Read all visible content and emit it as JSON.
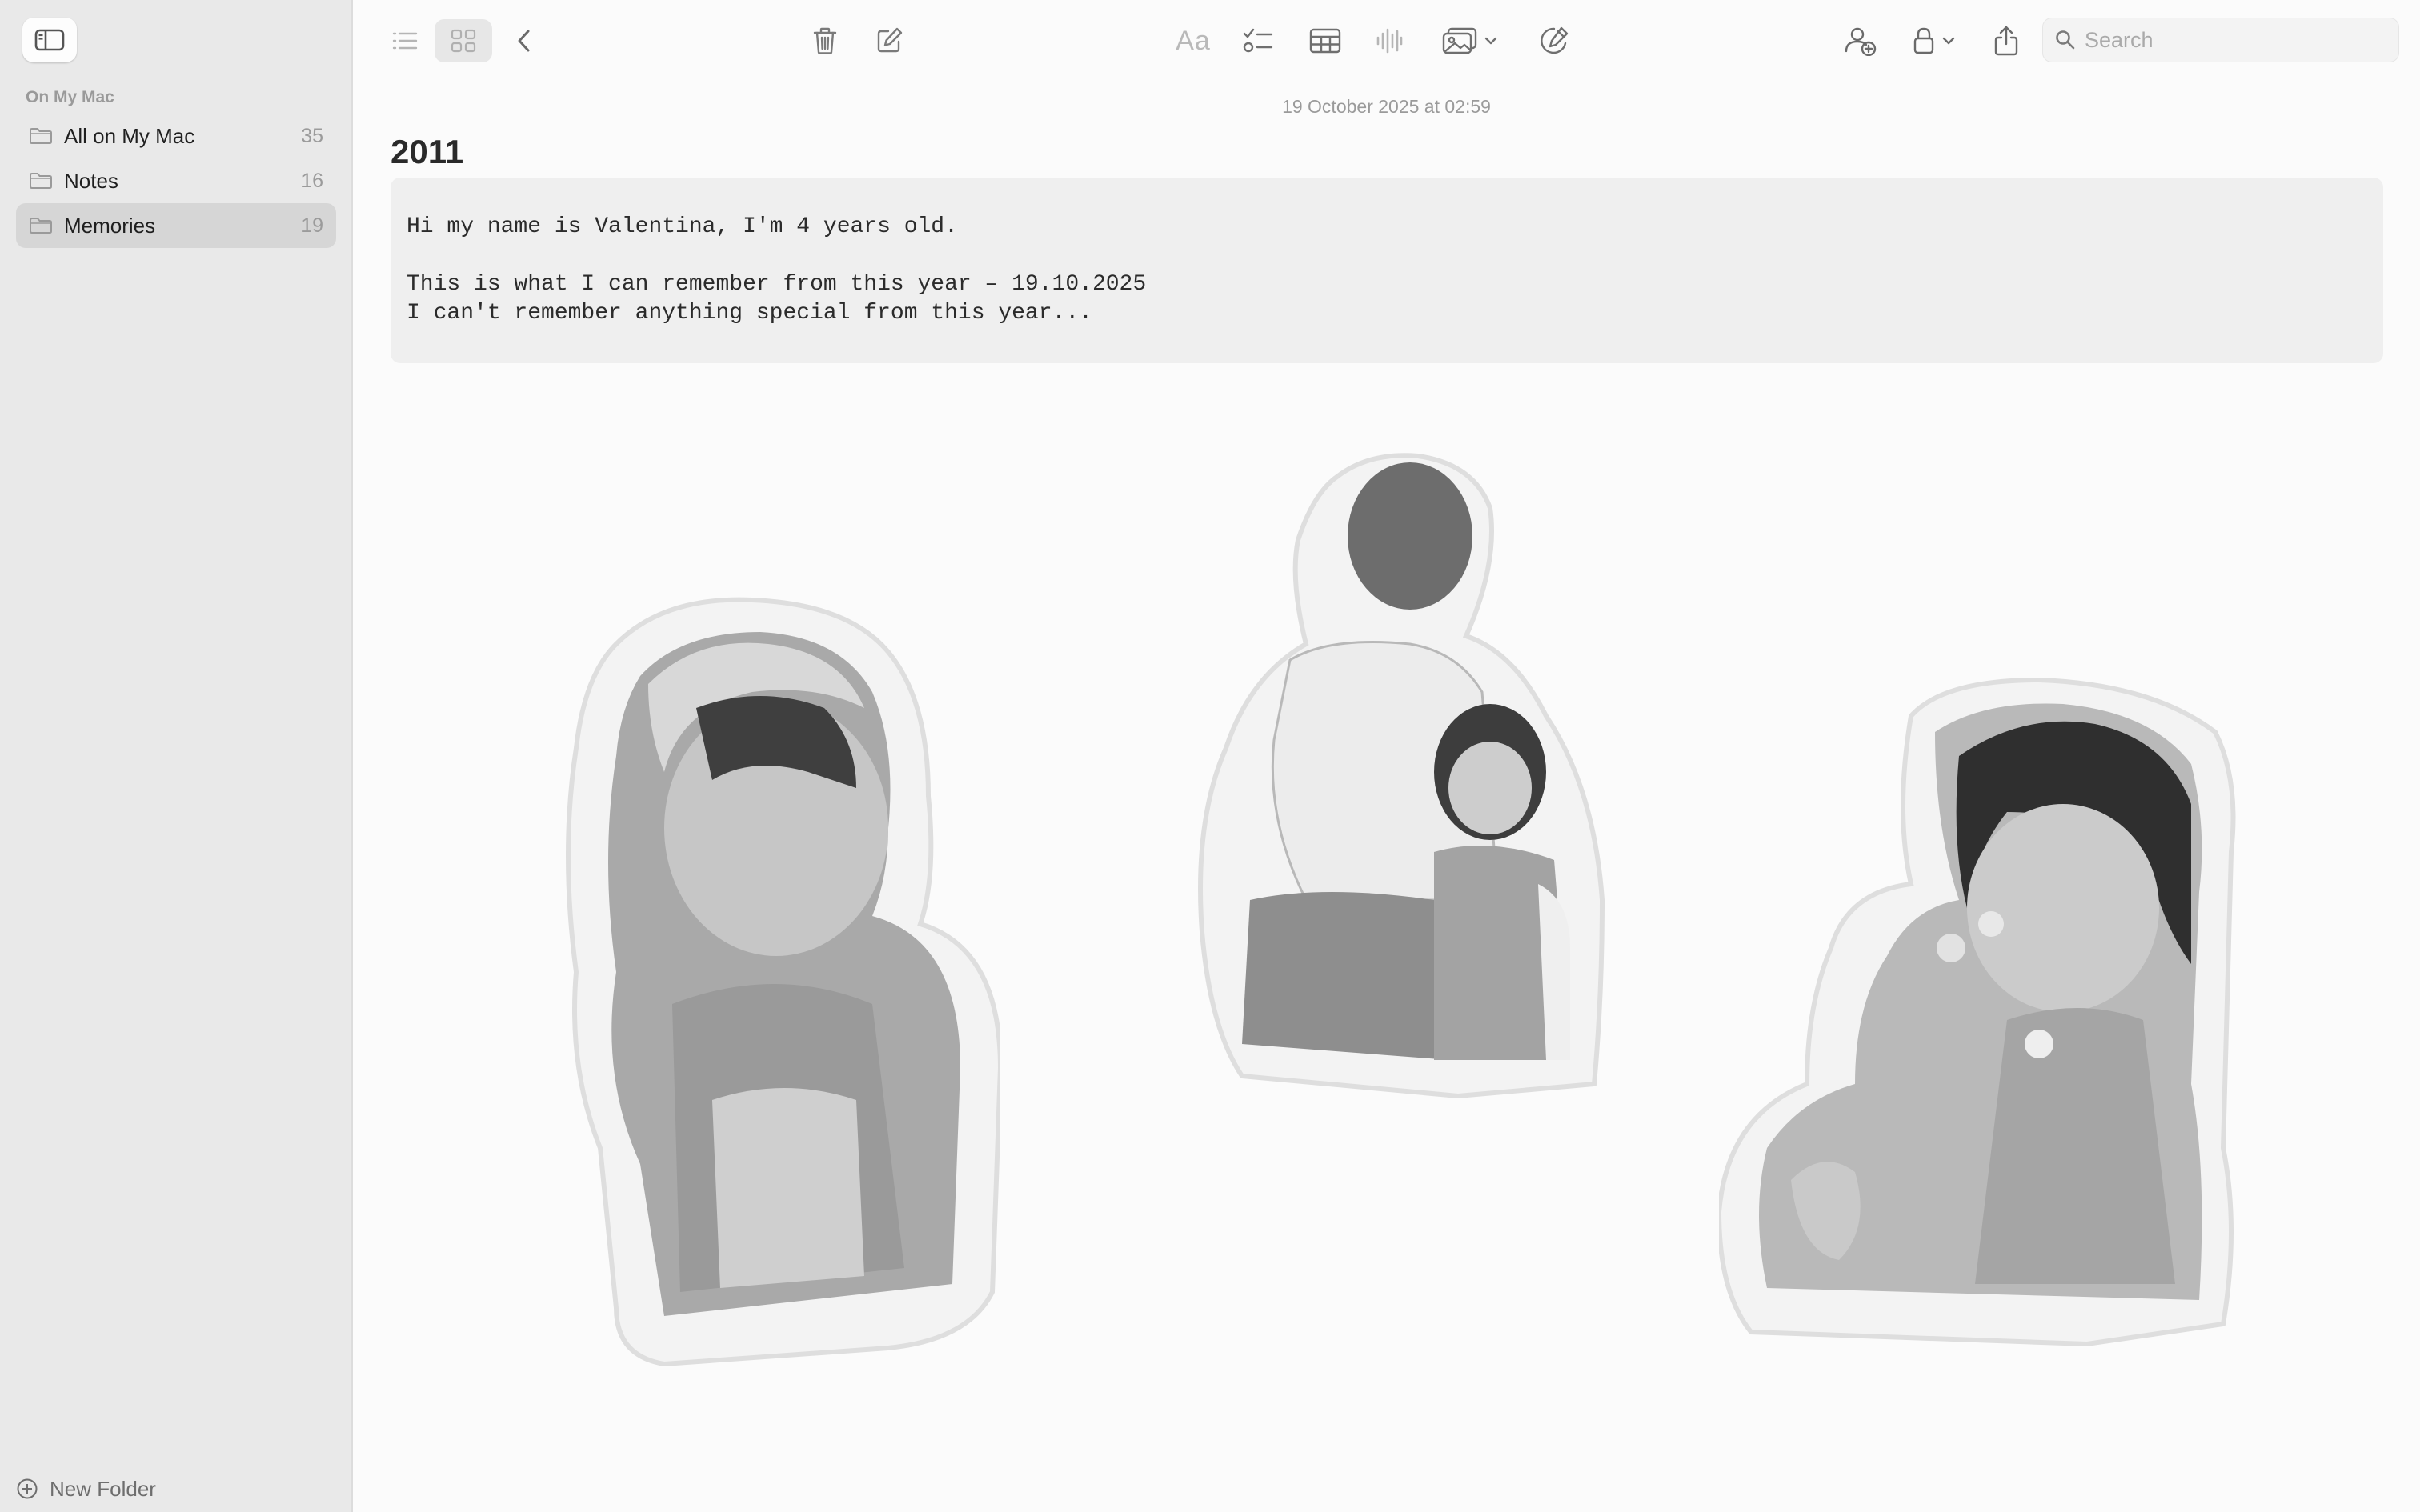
{
  "sidebar": {
    "toggle_icon": "sidebar-icon",
    "section_label": "On My Mac",
    "folders": [
      {
        "name": "All on My Mac",
        "count": "35",
        "icon": "folder-icon",
        "selected": false
      },
      {
        "name": "Notes",
        "count": "16",
        "icon": "folder-icon",
        "selected": false
      },
      {
        "name": "Memories",
        "count": "19",
        "icon": "folder-icon",
        "selected": true
      }
    ],
    "new_folder_label": "New Folder"
  },
  "toolbar": {
    "icons": [
      "list-view-icon",
      "gallery-view-icon",
      "back-chevron-icon",
      "trash-icon",
      "compose-icon",
      "format-text-icon",
      "checklist-icon",
      "table-icon",
      "audio-waveform-icon",
      "media-icon",
      "markup-icon",
      "collaborate-icon",
      "lock-icon",
      "share-icon"
    ],
    "format_label": "Aa",
    "search_placeholder": "Search"
  },
  "note": {
    "date": "19 October 2025 at 02:59",
    "title": "2011",
    "body_lines": [
      "Hi my name is Valentina, I'm 4 years old.",
      "",
      "This is what I can remember from this year – 19.10.2025",
      "I can't remember anything special from this year..."
    ]
  },
  "photos": [
    {
      "name": "photo-girl-headscarf",
      "style": "black-and-white cutout sticker"
    },
    {
      "name": "photo-two-girls",
      "style": "black-and-white cutout sticker"
    },
    {
      "name": "photo-girl-flowers",
      "style": "black-and-white cutout sticker"
    }
  ],
  "colors": {
    "sidebar_bg": "#e9e9e9",
    "selected_row": "#d6d6d6",
    "canvas_bg": "#fbfbfb",
    "code_block_bg": "#efefef",
    "icon_gray": "#7a7a7a"
  }
}
